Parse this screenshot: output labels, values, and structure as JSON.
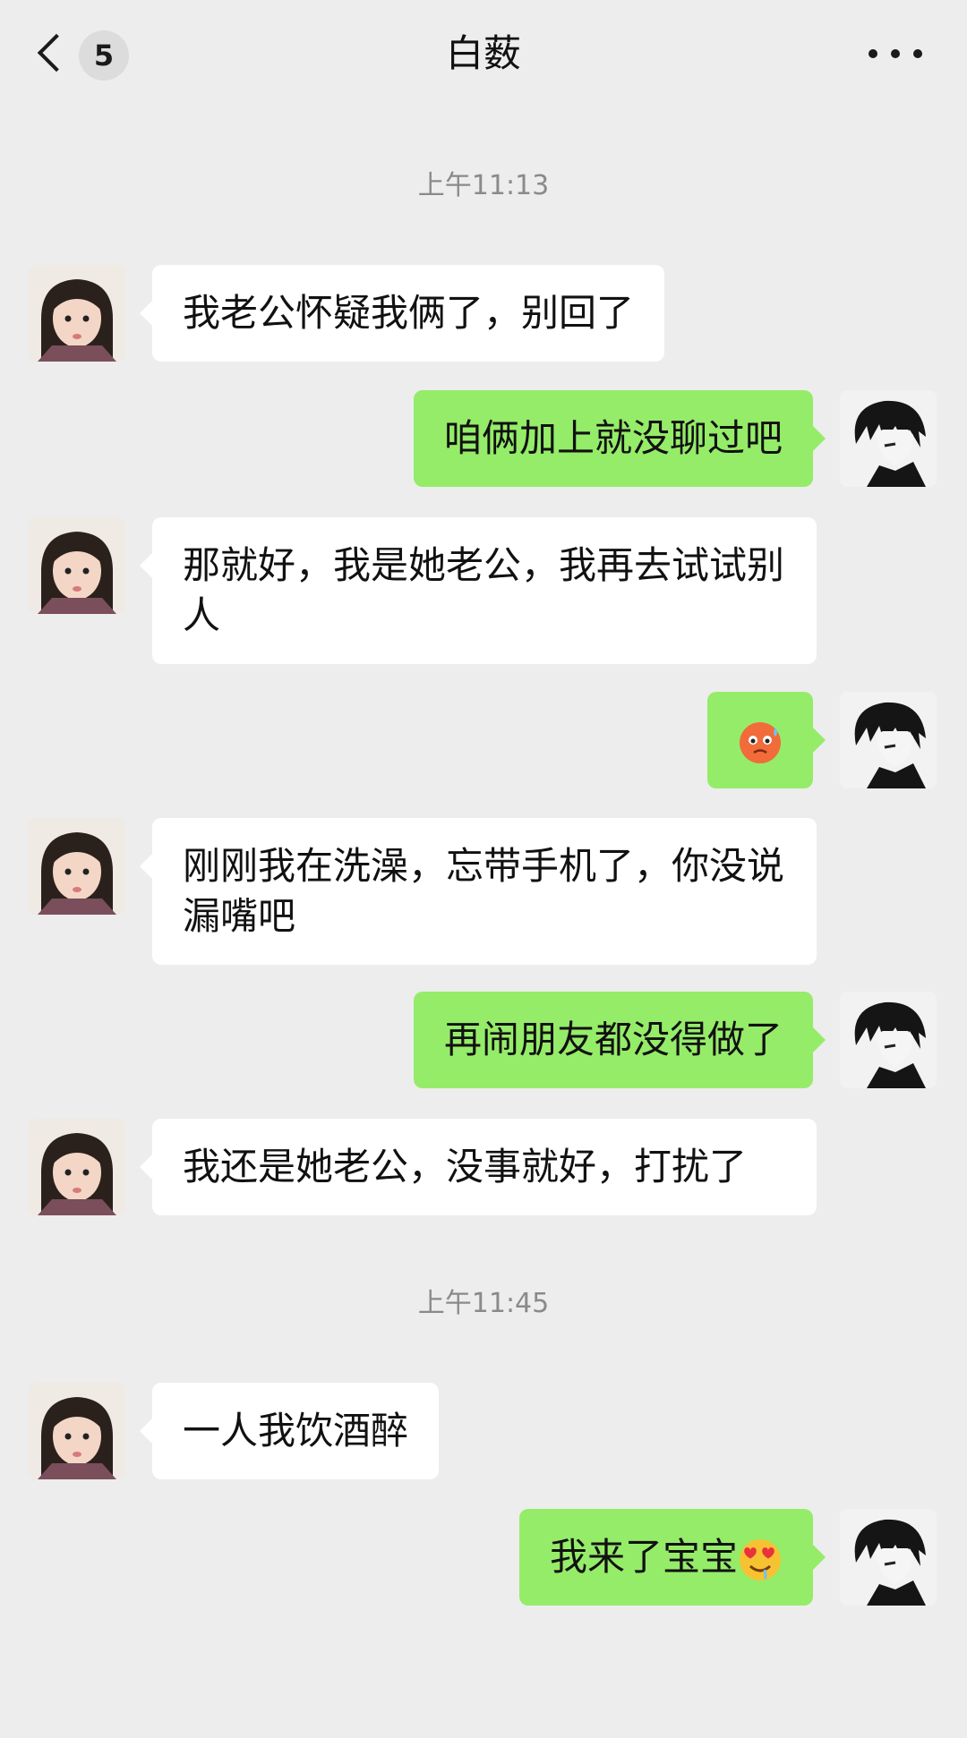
{
  "header": {
    "title": "白薮",
    "unread_count": "5"
  },
  "timestamps": [
    "上午11:13",
    "上午11:45"
  ],
  "messages": [
    {
      "side": "left",
      "text": "我老公怀疑我俩了，别回了"
    },
    {
      "side": "right",
      "text": "咱俩加上就没聊过吧"
    },
    {
      "side": "left",
      "text": "那就好，我是她老公，我再去试试别人"
    },
    {
      "side": "right",
      "text": "",
      "emoji": "worried-sweat-emoji"
    },
    {
      "side": "left",
      "text": "刚刚我在洗澡，忘带手机了，你没说漏嘴吧"
    },
    {
      "side": "right",
      "text": "再闹朋友都没得做了"
    },
    {
      "side": "left",
      "text": "我还是她老公，没事就好，打扰了"
    },
    {
      "side": "left",
      "text": "一人我饮酒醉"
    },
    {
      "side": "right",
      "text": "我来了宝宝",
      "emoji": "heart-eyes-drool-emoji"
    }
  ],
  "colors": {
    "background": "#ededed",
    "bubble_self": "#95ec69",
    "bubble_other": "#ffffff"
  }
}
